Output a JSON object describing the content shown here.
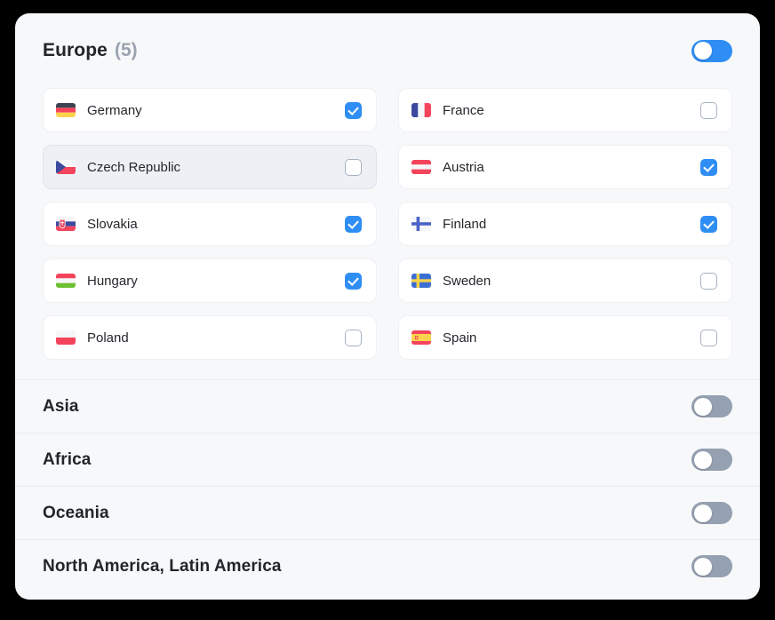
{
  "theme": {
    "page_background": "#000000",
    "card_background": "#f7f8fa",
    "row_background": "#ffffff",
    "accent_blue": "#2f8ef4",
    "toggle_off_gray": "#95a0b0",
    "count_text_gray": "#9aa3af",
    "title_text": "#22252a",
    "divider": "#e9ecf1",
    "hover_row_background": "#eef0f5"
  },
  "expanded_section": {
    "name": "Europe",
    "title": "Europe",
    "count_label": "(5)",
    "count": 5,
    "toggle": {
      "state": "on",
      "knob_position": "left"
    },
    "countries": [
      {
        "name": "Germany",
        "flag": "flag-germany",
        "checked": true,
        "hovered": false,
        "column": "left"
      },
      {
        "name": "France",
        "flag": "flag-france",
        "checked": false,
        "hovered": false,
        "column": "right"
      },
      {
        "name": "Czech Republic",
        "flag": "flag-czech-republic",
        "checked": false,
        "hovered": true,
        "column": "left"
      },
      {
        "name": "Austria",
        "flag": "flag-austria",
        "checked": true,
        "hovered": false,
        "column": "right"
      },
      {
        "name": "Slovakia",
        "flag": "flag-slovakia",
        "checked": true,
        "hovered": false,
        "column": "left"
      },
      {
        "name": "Finland",
        "flag": "flag-finland",
        "checked": true,
        "hovered": false,
        "column": "right"
      },
      {
        "name": "Hungary",
        "flag": "flag-hungary",
        "checked": true,
        "hovered": false,
        "column": "left"
      },
      {
        "name": "Sweden",
        "flag": "flag-sweden",
        "checked": false,
        "hovered": false,
        "column": "right"
      },
      {
        "name": "Poland",
        "flag": "flag-poland",
        "checked": false,
        "hovered": false,
        "column": "left"
      },
      {
        "name": "Spain",
        "flag": "flag-spain",
        "checked": false,
        "hovered": false,
        "column": "right"
      }
    ]
  },
  "collapsed_sections": [
    {
      "name": "Asia",
      "toggle": {
        "state": "off",
        "knob_position": "left"
      }
    },
    {
      "name": "Africa",
      "toggle": {
        "state": "off",
        "knob_position": "left"
      }
    },
    {
      "name": "Oceania",
      "toggle": {
        "state": "off",
        "knob_position": "left"
      }
    },
    {
      "name": "North America, Latin America",
      "toggle": {
        "state": "off",
        "knob_position": "left"
      }
    }
  ]
}
